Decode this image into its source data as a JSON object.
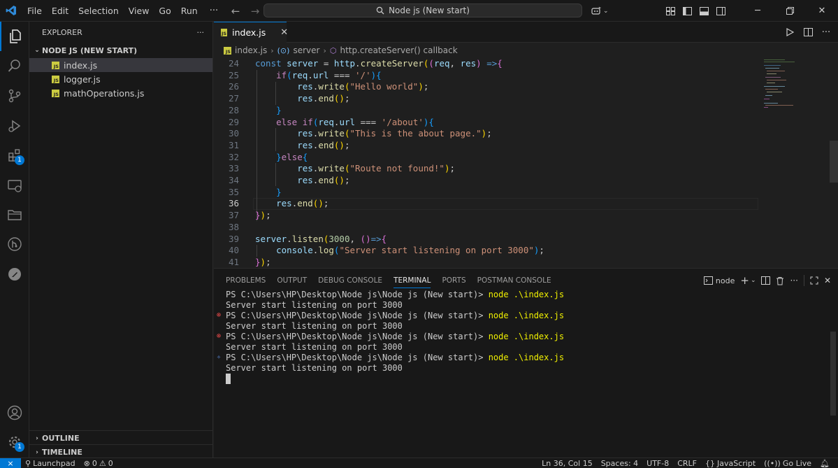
{
  "menu": {
    "items": [
      "File",
      "Edit",
      "Selection",
      "View",
      "Go",
      "Run"
    ],
    "more": "···"
  },
  "command_center": {
    "text": "Node js (New start)"
  },
  "sidebar": {
    "title": "EXPLORER",
    "more": "···",
    "folder": "NODE JS (NEW START)",
    "files": [
      "index.js",
      "logger.js",
      "mathOperations.js"
    ],
    "outline": "OUTLINE",
    "timeline": "TIMELINE"
  },
  "activity_badges": {
    "extensions": "1",
    "accounts_manage": "1"
  },
  "tab": {
    "label": "index.js",
    "icon_text": "JS"
  },
  "breadcrumb": {
    "file": "index.js",
    "symbol1": "server",
    "symbol2": "http.createServer() callback"
  },
  "editor": {
    "line_numbers": [
      "24",
      "25",
      "26",
      "27",
      "28",
      "29",
      "30",
      "31",
      "32",
      "33",
      "34",
      "35",
      "36",
      "37",
      "38",
      "39",
      "40",
      "41"
    ],
    "current_line": "36"
  },
  "panel": {
    "tabs": [
      "PROBLEMS",
      "OUTPUT",
      "DEBUG CONSOLE",
      "TERMINAL",
      "PORTS",
      "POSTMAN CONSOLE"
    ],
    "active_tab": "TERMINAL",
    "terminal_name": "node"
  },
  "terminal": {
    "prompt": "PS C:\\Users\\HP\\Desktop\\Node js\\Node js (New start)> ",
    "command": "node .\\index.js",
    "output": "Server start listening on port 3000"
  },
  "statusbar": {
    "launchpad": "Launchpad",
    "errors": "0",
    "warnings": "0",
    "position": "Ln 36, Col 15",
    "spaces": "Spaces: 4",
    "encoding": "UTF-8",
    "eol": "CRLF",
    "language": "JavaScript",
    "golive": "Go Live"
  },
  "colors": {
    "accent": "#0078d4",
    "js_icon": "#cbcb41",
    "error": "#f14c4c"
  }
}
